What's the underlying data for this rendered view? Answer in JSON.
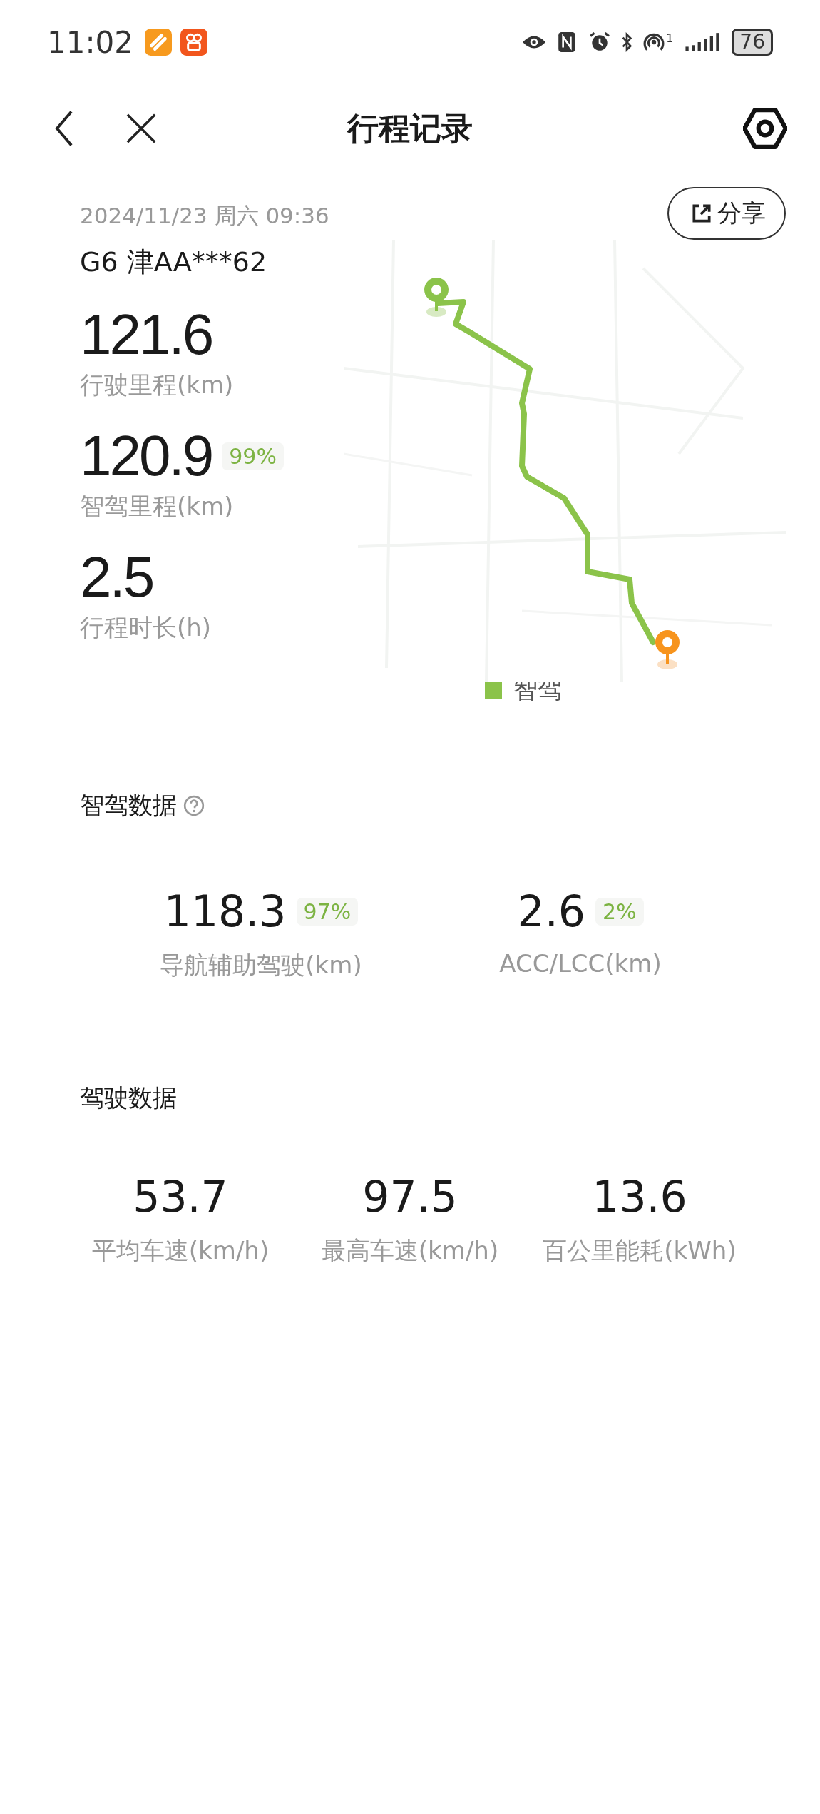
{
  "status_bar": {
    "time": "11:02",
    "hotspot_count": "1",
    "battery": "76"
  },
  "header": {
    "title": "行程记录"
  },
  "trip": {
    "date": "2024/11/23 周六 09:36",
    "vehicle": "G6 津AA***62",
    "share": "分享",
    "stats": [
      {
        "value": "121.6",
        "label": "行驶里程(km)"
      },
      {
        "value": "120.9",
        "label": "智驾里程(km)",
        "badge": "99%"
      },
      {
        "value": "2.5",
        "label": "行程时长(h)"
      }
    ],
    "legend": {
      "label": "智驾",
      "color": "#8bc34a"
    }
  },
  "smart_section": {
    "title": "智驾数据",
    "items": [
      {
        "value": "118.3",
        "badge": "97%",
        "label": "导航辅助驾驶(km)"
      },
      {
        "value": "2.6",
        "badge": "2%",
        "label": "ACC/LCC(km)"
      }
    ]
  },
  "drive_section": {
    "title": "驾驶数据",
    "items": [
      {
        "value": "53.7",
        "label": "平均车速(km/h)"
      },
      {
        "value": "97.5",
        "label": "最高车速(km/h)"
      },
      {
        "value": "13.6",
        "label": "百公里能耗(kWh)"
      }
    ]
  }
}
